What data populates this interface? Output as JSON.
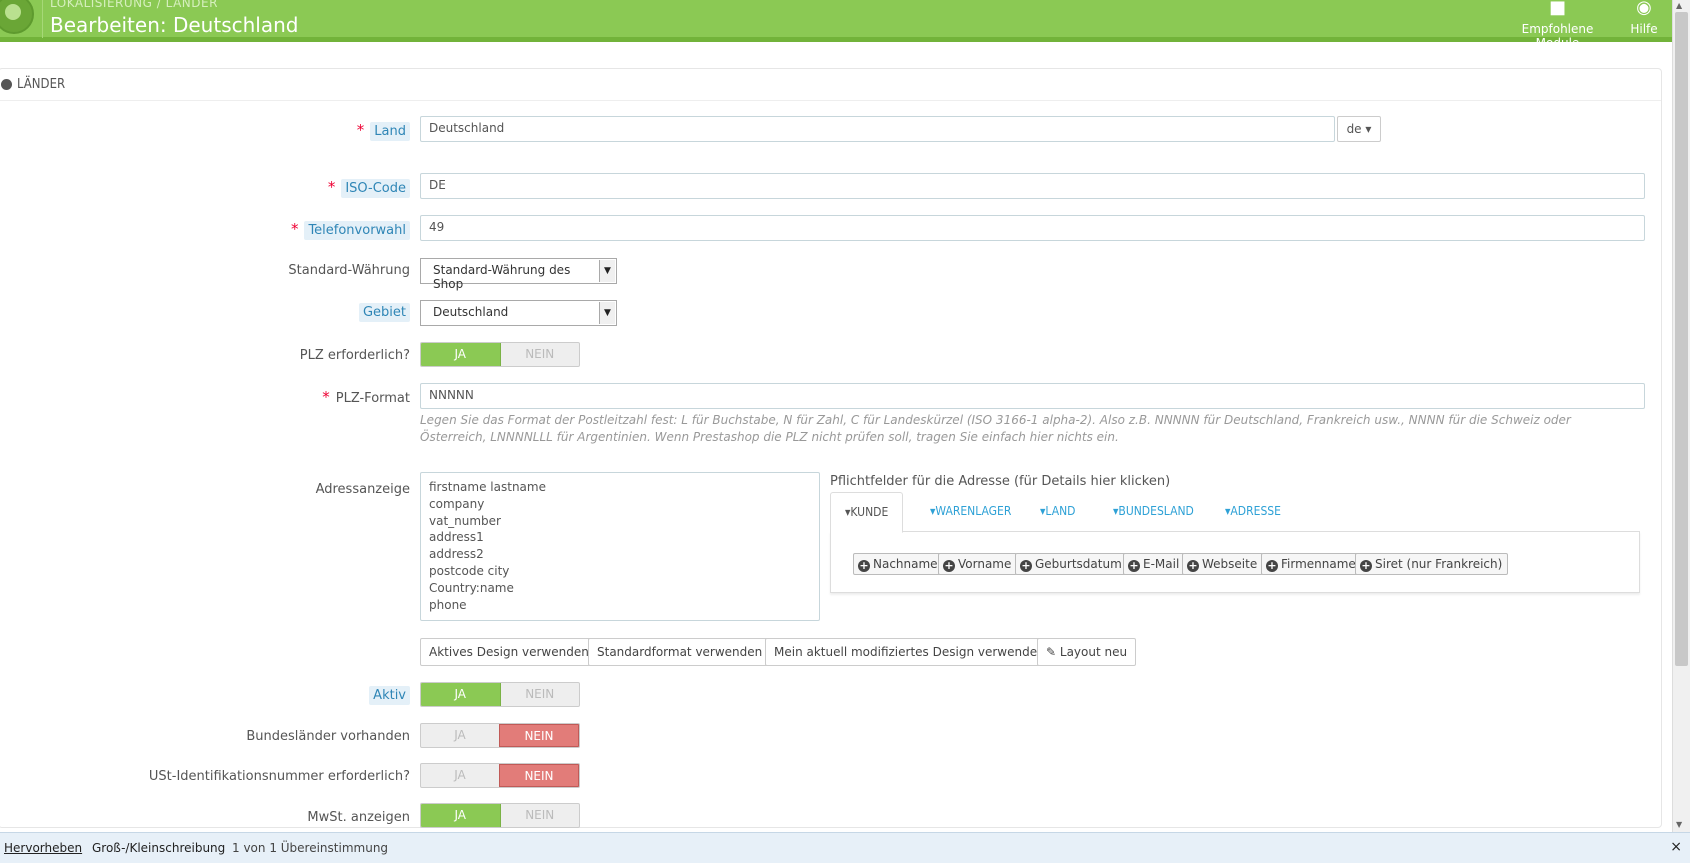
{
  "header": {
    "breadcrumb": "LOKALISIERUNG  /  LÄNDER",
    "title": "Bearbeiten: Deutschland",
    "modules_label": "Empfohlene Module",
    "help_label": "Hilfe"
  },
  "panel": {
    "heading": "LÄNDER"
  },
  "form": {
    "country_label": "Land",
    "country_value": "Deutschland",
    "lang": "de",
    "iso_label": "ISO-Code",
    "iso_value": "DE",
    "phone_label": "Telefonvorwahl",
    "phone_value": "49",
    "currency_label": "Standard-Währung",
    "currency_value": "Standard-Währung des Shop",
    "zone_label": "Gebiet",
    "zone_value": "Deutschland",
    "zip_required_label": "PLZ erforderlich?",
    "zip_format_label": "PLZ-Format",
    "zip_format_value": "NNNNN",
    "zip_help": "Legen Sie das Format der Postleitzahl fest: L für Buchstabe, N für Zahl, C für Landeskürzel (ISO 3166-1 alpha-2). Also z.B. NNNNN für Deutschland, Frankreich usw., NNNN für die Schweiz oder Österreich, LNNNNLLL für Argentinien. Wenn Prestashop die PLZ nicht prüfen soll, tragen Sie einfach hier nichts ein.",
    "address_label": "Adressanzeige",
    "address_lines": [
      "firstname lastname",
      "company",
      "vat_number",
      "address1",
      "address2",
      "postcode city",
      "Country:name",
      "phone"
    ],
    "required_fields_title": "Pflichtfelder für die Adresse (für Details hier klicken)",
    "tabs": [
      "KUNDE",
      "WARENLAGER",
      "LAND",
      "BUNDESLAND",
      "ADRESSE"
    ],
    "field_buttons": [
      "Nachname",
      "Vorname",
      "Geburtsdatum",
      "E-Mail",
      "Webseite",
      "Firmenname",
      "Siret (nur Frankreich)"
    ],
    "layout_buttons": [
      "Aktives Design verwenden",
      "Standardformat verwenden",
      "Mein aktuell modifiziertes Design verwenden",
      "Layout neu"
    ],
    "active_label": "Aktiv",
    "states_label": "Bundesländer vorhanden",
    "vat_required_label": "USt-Identifikationsnummer erforderlich?",
    "show_tax_label": "MwSt. anzeigen",
    "yes": "JA",
    "no": "NEIN"
  },
  "findbar": {
    "highlight": "Hervorheben",
    "case": "Groß-/Kleinschreibung",
    "result": "1 von 1 Übereinstimmung",
    "close": "×"
  }
}
